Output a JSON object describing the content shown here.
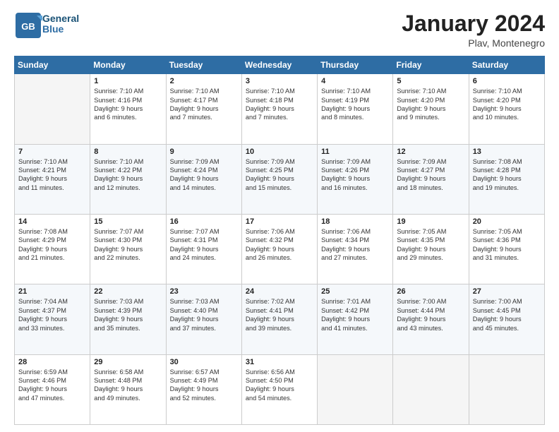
{
  "header": {
    "logo_text_general": "General",
    "logo_text_blue": "Blue",
    "month": "January 2024",
    "location": "Plav, Montenegro"
  },
  "days_of_week": [
    "Sunday",
    "Monday",
    "Tuesday",
    "Wednesday",
    "Thursday",
    "Friday",
    "Saturday"
  ],
  "weeks": [
    [
      {
        "day": "",
        "sunrise": "",
        "sunset": "",
        "daylight": ""
      },
      {
        "day": "1",
        "sunrise": "Sunrise: 7:10 AM",
        "sunset": "Sunset: 4:16 PM",
        "daylight": "Daylight: 9 hours and 6 minutes."
      },
      {
        "day": "2",
        "sunrise": "Sunrise: 7:10 AM",
        "sunset": "Sunset: 4:17 PM",
        "daylight": "Daylight: 9 hours and 7 minutes."
      },
      {
        "day": "3",
        "sunrise": "Sunrise: 7:10 AM",
        "sunset": "Sunset: 4:18 PM",
        "daylight": "Daylight: 9 hours and 7 minutes."
      },
      {
        "day": "4",
        "sunrise": "Sunrise: 7:10 AM",
        "sunset": "Sunset: 4:19 PM",
        "daylight": "Daylight: 9 hours and 8 minutes."
      },
      {
        "day": "5",
        "sunrise": "Sunrise: 7:10 AM",
        "sunset": "Sunset: 4:20 PM",
        "daylight": "Daylight: 9 hours and 9 minutes."
      },
      {
        "day": "6",
        "sunrise": "Sunrise: 7:10 AM",
        "sunset": "Sunset: 4:20 PM",
        "daylight": "Daylight: 9 hours and 10 minutes."
      }
    ],
    [
      {
        "day": "7",
        "sunrise": "Sunrise: 7:10 AM",
        "sunset": "Sunset: 4:21 PM",
        "daylight": "Daylight: 9 hours and 11 minutes."
      },
      {
        "day": "8",
        "sunrise": "Sunrise: 7:10 AM",
        "sunset": "Sunset: 4:22 PM",
        "daylight": "Daylight: 9 hours and 12 minutes."
      },
      {
        "day": "9",
        "sunrise": "Sunrise: 7:09 AM",
        "sunset": "Sunset: 4:24 PM",
        "daylight": "Daylight: 9 hours and 14 minutes."
      },
      {
        "day": "10",
        "sunrise": "Sunrise: 7:09 AM",
        "sunset": "Sunset: 4:25 PM",
        "daylight": "Daylight: 9 hours and 15 minutes."
      },
      {
        "day": "11",
        "sunrise": "Sunrise: 7:09 AM",
        "sunset": "Sunset: 4:26 PM",
        "daylight": "Daylight: 9 hours and 16 minutes."
      },
      {
        "day": "12",
        "sunrise": "Sunrise: 7:09 AM",
        "sunset": "Sunset: 4:27 PM",
        "daylight": "Daylight: 9 hours and 18 minutes."
      },
      {
        "day": "13",
        "sunrise": "Sunrise: 7:08 AM",
        "sunset": "Sunset: 4:28 PM",
        "daylight": "Daylight: 9 hours and 19 minutes."
      }
    ],
    [
      {
        "day": "14",
        "sunrise": "Sunrise: 7:08 AM",
        "sunset": "Sunset: 4:29 PM",
        "daylight": "Daylight: 9 hours and 21 minutes."
      },
      {
        "day": "15",
        "sunrise": "Sunrise: 7:07 AM",
        "sunset": "Sunset: 4:30 PM",
        "daylight": "Daylight: 9 hours and 22 minutes."
      },
      {
        "day": "16",
        "sunrise": "Sunrise: 7:07 AM",
        "sunset": "Sunset: 4:31 PM",
        "daylight": "Daylight: 9 hours and 24 minutes."
      },
      {
        "day": "17",
        "sunrise": "Sunrise: 7:06 AM",
        "sunset": "Sunset: 4:32 PM",
        "daylight": "Daylight: 9 hours and 26 minutes."
      },
      {
        "day": "18",
        "sunrise": "Sunrise: 7:06 AM",
        "sunset": "Sunset: 4:34 PM",
        "daylight": "Daylight: 9 hours and 27 minutes."
      },
      {
        "day": "19",
        "sunrise": "Sunrise: 7:05 AM",
        "sunset": "Sunset: 4:35 PM",
        "daylight": "Daylight: 9 hours and 29 minutes."
      },
      {
        "day": "20",
        "sunrise": "Sunrise: 7:05 AM",
        "sunset": "Sunset: 4:36 PM",
        "daylight": "Daylight: 9 hours and 31 minutes."
      }
    ],
    [
      {
        "day": "21",
        "sunrise": "Sunrise: 7:04 AM",
        "sunset": "Sunset: 4:37 PM",
        "daylight": "Daylight: 9 hours and 33 minutes."
      },
      {
        "day": "22",
        "sunrise": "Sunrise: 7:03 AM",
        "sunset": "Sunset: 4:39 PM",
        "daylight": "Daylight: 9 hours and 35 minutes."
      },
      {
        "day": "23",
        "sunrise": "Sunrise: 7:03 AM",
        "sunset": "Sunset: 4:40 PM",
        "daylight": "Daylight: 9 hours and 37 minutes."
      },
      {
        "day": "24",
        "sunrise": "Sunrise: 7:02 AM",
        "sunset": "Sunset: 4:41 PM",
        "daylight": "Daylight: 9 hours and 39 minutes."
      },
      {
        "day": "25",
        "sunrise": "Sunrise: 7:01 AM",
        "sunset": "Sunset: 4:42 PM",
        "daylight": "Daylight: 9 hours and 41 minutes."
      },
      {
        "day": "26",
        "sunrise": "Sunrise: 7:00 AM",
        "sunset": "Sunset: 4:44 PM",
        "daylight": "Daylight: 9 hours and 43 minutes."
      },
      {
        "day": "27",
        "sunrise": "Sunrise: 7:00 AM",
        "sunset": "Sunset: 4:45 PM",
        "daylight": "Daylight: 9 hours and 45 minutes."
      }
    ],
    [
      {
        "day": "28",
        "sunrise": "Sunrise: 6:59 AM",
        "sunset": "Sunset: 4:46 PM",
        "daylight": "Daylight: 9 hours and 47 minutes."
      },
      {
        "day": "29",
        "sunrise": "Sunrise: 6:58 AM",
        "sunset": "Sunset: 4:48 PM",
        "daylight": "Daylight: 9 hours and 49 minutes."
      },
      {
        "day": "30",
        "sunrise": "Sunrise: 6:57 AM",
        "sunset": "Sunset: 4:49 PM",
        "daylight": "Daylight: 9 hours and 52 minutes."
      },
      {
        "day": "31",
        "sunrise": "Sunrise: 6:56 AM",
        "sunset": "Sunset: 4:50 PM",
        "daylight": "Daylight: 9 hours and 54 minutes."
      },
      {
        "day": "",
        "sunrise": "",
        "sunset": "",
        "daylight": ""
      },
      {
        "day": "",
        "sunrise": "",
        "sunset": "",
        "daylight": ""
      },
      {
        "day": "",
        "sunrise": "",
        "sunset": "",
        "daylight": ""
      }
    ]
  ]
}
